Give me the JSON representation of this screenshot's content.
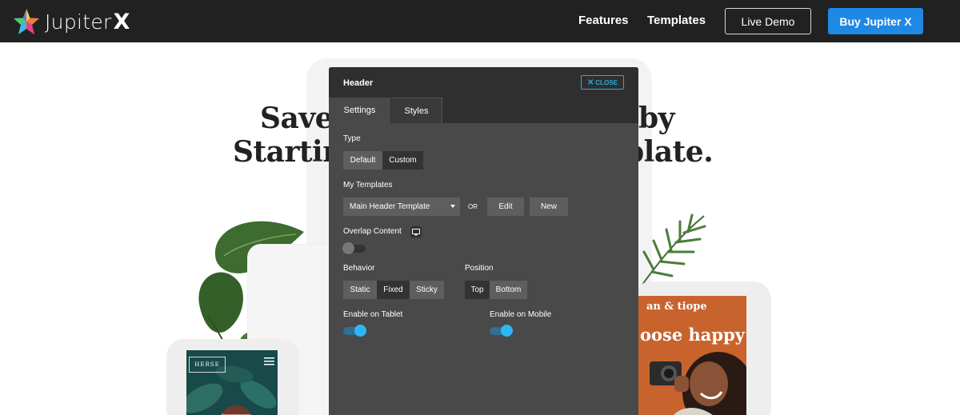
{
  "navbar": {
    "logo_text": "Jupiter",
    "logo_x": "X",
    "links": [
      "Features",
      "Templates"
    ],
    "live_demo": "Live Demo",
    "buy": "Buy Jupiter X"
  },
  "hero": {
    "line1_left": "Save",
    "line1_right": "by",
    "line2_left": "Startin",
    "line2_right": "plate."
  },
  "mockups": {
    "left_phone_brand": "HERSE",
    "right_phone_brand": "an & tiope",
    "right_phone_tagline": "oose happy"
  },
  "panel": {
    "title": "Header",
    "close_label": "CLOSE",
    "tabs": [
      "Settings",
      "Styles"
    ],
    "type": {
      "label": "Type",
      "options": [
        "Default",
        "Custom"
      ],
      "selected": "Custom"
    },
    "my_templates": {
      "label": "My Templates",
      "selected": "Main Header Template",
      "or": "OR",
      "edit": "Edit",
      "new": "New"
    },
    "overlap": {
      "label": "Overlap Content",
      "icon": "monitor-icon",
      "on": false
    },
    "behavior": {
      "label": "Behavior",
      "options": [
        "Static",
        "Fixed",
        "Sticky"
      ],
      "selected": "Fixed"
    },
    "position": {
      "label": "Position",
      "options": [
        "Top",
        "Bottom"
      ],
      "selected": "Top"
    },
    "tablet": {
      "label": "Enable on Tablet",
      "on": true
    },
    "mobile": {
      "label": "Enable on Mobile",
      "on": true
    }
  },
  "colors": {
    "navbar_bg": "#212121",
    "accent_blue": "#1e88e5",
    "panel_bg": "#494949",
    "toggle_on": "#2fb7f5"
  }
}
